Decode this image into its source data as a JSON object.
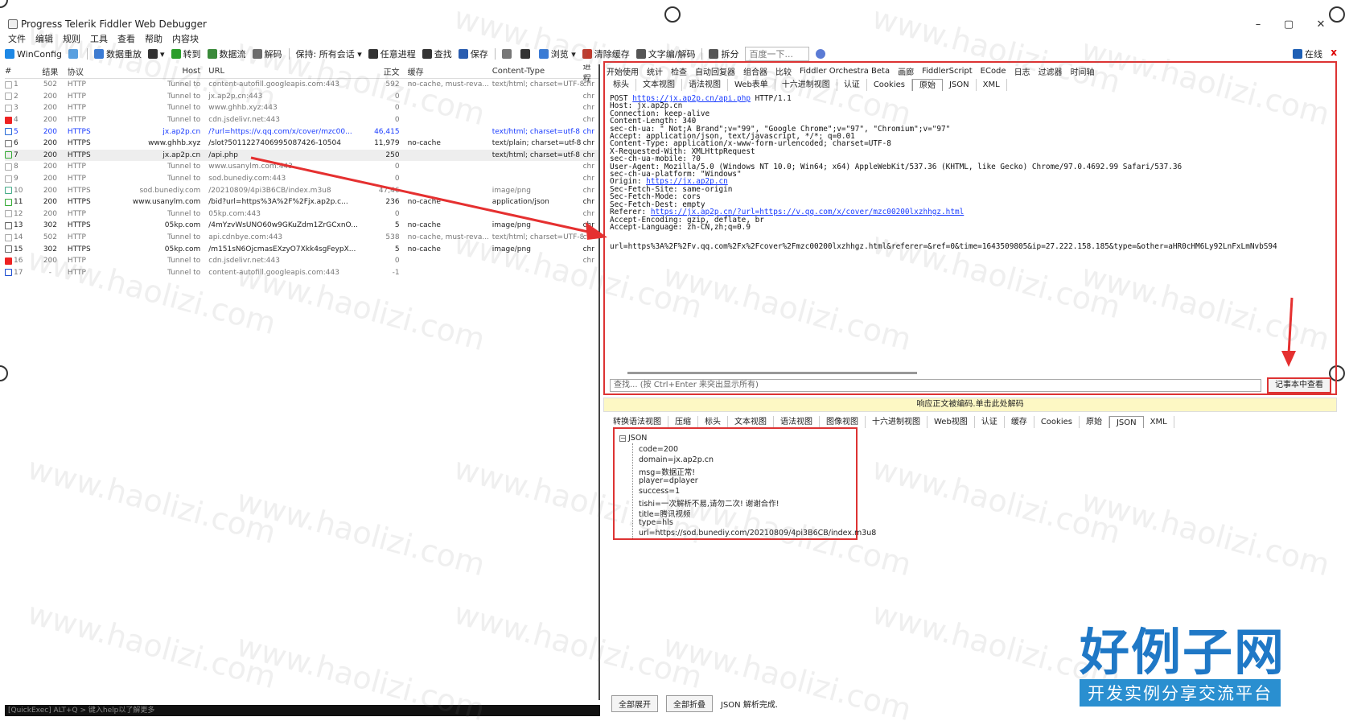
{
  "window": {
    "title": "Progress Telerik Fiddler Web Debugger",
    "minimize": "–",
    "maximize": "▢",
    "close": "✕"
  },
  "menu": [
    "文件",
    "编辑",
    "规则",
    "工具",
    "查看",
    "帮助",
    "内容块"
  ],
  "toolbar": {
    "items": [
      {
        "label": "WinConfig",
        "icon": "windows-icon",
        "color": "#1e88e5"
      },
      {
        "label": "",
        "icon": "comment-icon",
        "color": "#5aa0e0"
      },
      {
        "label": "数据重放",
        "icon": "replay-icon",
        "color": "#3a7bd5"
      },
      {
        "label": "▾",
        "icon": "remove-icon",
        "color": "#333333"
      },
      {
        "label": "转到",
        "icon": "go-icon",
        "color": "#2a9d2a"
      },
      {
        "label": "数据流",
        "icon": "stream-icon",
        "color": "#3a8a3a"
      },
      {
        "label": "解码",
        "icon": "decode-icon",
        "color": "#6a6a6a"
      },
      {
        "label": "保持: 所有会话 ▾",
        "icon": "",
        "color": ""
      },
      {
        "label": "任意进程",
        "icon": "target-icon",
        "color": "#333333"
      },
      {
        "label": "查找",
        "icon": "binoculars-icon",
        "color": "#333333"
      },
      {
        "label": "保存",
        "icon": "save-icon",
        "color": "#2a5db0"
      },
      {
        "label": "",
        "icon": "camera-icon",
        "color": "#777777"
      },
      {
        "label": "",
        "icon": "timer-icon",
        "color": "#333333"
      },
      {
        "label": "浏览 ▾",
        "icon": "browse-icon",
        "color": "#3a7bd5"
      },
      {
        "label": "清除缓存",
        "icon": "clear-cache-icon",
        "color": "#c0392b"
      },
      {
        "label": "文字编/解码",
        "icon": "text-encode-icon",
        "color": "#555555"
      },
      {
        "label": "拆分",
        "icon": "split-icon",
        "color": "#555555"
      }
    ],
    "search_placeholder": "百度一下...",
    "online": "在线",
    "close_x": "x"
  },
  "sessions": {
    "columns": [
      "#",
      "结果",
      "协议",
      "Host",
      "URL",
      "正文",
      "缓存",
      "Content-Type",
      "进程"
    ],
    "rows": [
      {
        "id": "1",
        "result": "502",
        "proto": "HTTP",
        "host": "Tunnel to",
        "url": "content-autofill.googleapis.com:443",
        "body": "592",
        "cache": "no-cache, must-reva...",
        "ct": "text/html; charset=UTF-8",
        "proc": "chr",
        "style": "gray",
        "icon": "lock-icon"
      },
      {
        "id": "2",
        "result": "200",
        "proto": "HTTP",
        "host": "Tunnel to",
        "url": "jx.ap2p.cn:443",
        "body": "0",
        "cache": "",
        "ct": "",
        "proc": "chr",
        "style": "gray",
        "icon": "lock-icon"
      },
      {
        "id": "3",
        "result": "200",
        "proto": "HTTP",
        "host": "Tunnel to",
        "url": "www.ghhb.xyz:443",
        "body": "0",
        "cache": "",
        "ct": "",
        "proc": "chr",
        "style": "gray",
        "icon": "lock-icon"
      },
      {
        "id": "4",
        "result": "200",
        "proto": "HTTP",
        "host": "Tunnel to",
        "url": "cdn.jsdelivr.net:443",
        "body": "0",
        "cache": "",
        "ct": "",
        "proc": "chr",
        "style": "gray",
        "icon": "warning-icon"
      },
      {
        "id": "5",
        "result": "200",
        "proto": "HTTPS",
        "host": "jx.ap2p.cn",
        "url": "/?url=https://v.qq.com/x/cover/mzc00...",
        "body": "46,415",
        "cache": "",
        "ct": "text/html; charset=utf-8",
        "proc": "chr",
        "style": "blue",
        "icon": "html-icon"
      },
      {
        "id": "6",
        "result": "200",
        "proto": "HTTPS",
        "host": "www.ghhb.xyz",
        "url": "/slot?5011227406995087426-10504",
        "body": "11,979",
        "cache": "no-cache",
        "ct": "text/plain; charset=utf-8",
        "proc": "chr",
        "style": "dark",
        "icon": "doc-icon"
      },
      {
        "id": "7",
        "result": "200",
        "proto": "HTTPS",
        "host": "jx.ap2p.cn",
        "url": "/api.php",
        "body": "250",
        "cache": "",
        "ct": "text/html; charset=utf-8",
        "proc": "chr",
        "style": "dark",
        "icon": "json-icon"
      },
      {
        "id": "8",
        "result": "200",
        "proto": "HTTP",
        "host": "Tunnel to",
        "url": "www.usanylm.com:443",
        "body": "0",
        "cache": "",
        "ct": "",
        "proc": "chr",
        "style": "gray",
        "icon": "lock-icon"
      },
      {
        "id": "9",
        "result": "200",
        "proto": "HTTP",
        "host": "Tunnel to",
        "url": "sod.bunediy.com:443",
        "body": "0",
        "cache": "",
        "ct": "",
        "proc": "chr",
        "style": "gray",
        "icon": "lock-icon"
      },
      {
        "id": "10",
        "result": "200",
        "proto": "HTTPS",
        "host": "sod.bunediy.com",
        "url": "/20210809/4pi3B6CB/index.m3u8",
        "body": "47,46",
        "cache": "",
        "ct": "image/png",
        "proc": "chr",
        "style": "gray",
        "icon": "image-icon"
      },
      {
        "id": "11",
        "result": "200",
        "proto": "HTTPS",
        "host": "www.usanylm.com",
        "url": "/bid?url=https%3A%2F%2Fjx.ap2p.c...",
        "body": "236",
        "cache": "no-cache",
        "ct": "application/json",
        "proc": "chr",
        "style": "dark",
        "icon": "json-icon"
      },
      {
        "id": "12",
        "result": "200",
        "proto": "HTTP",
        "host": "Tunnel to",
        "url": "05kp.com:443",
        "body": "0",
        "cache": "",
        "ct": "",
        "proc": "chr",
        "style": "gray",
        "icon": "lock-icon"
      },
      {
        "id": "13",
        "result": "302",
        "proto": "HTTPS",
        "host": "05kp.com",
        "url": "/4mYzvWsUNO60w9GKuZdm1ZrGCxnO...",
        "body": "5",
        "cache": "no-cache",
        "ct": "image/png",
        "proc": "chr",
        "style": "dark",
        "icon": "redirect-icon"
      },
      {
        "id": "14",
        "result": "502",
        "proto": "HTTP",
        "host": "Tunnel to",
        "url": "api.cdnbye.com:443",
        "body": "538",
        "cache": "no-cache, must-reva...",
        "ct": "text/html; charset=UTF-8",
        "proc": "chr",
        "style": "gray",
        "icon": "lock-icon"
      },
      {
        "id": "15",
        "result": "302",
        "proto": "HTTPS",
        "host": "05kp.com",
        "url": "/m151sN6OjcmasEXzyO7Xkk4sgFeypX...",
        "body": "5",
        "cache": "no-cache",
        "ct": "image/png",
        "proc": "chr",
        "style": "dark",
        "icon": "redirect-icon"
      },
      {
        "id": "16",
        "result": "200",
        "proto": "HTTP",
        "host": "Tunnel to",
        "url": "cdn.jsdelivr.net:443",
        "body": "0",
        "cache": "",
        "ct": "",
        "proc": "chr",
        "style": "gray",
        "icon": "warning-icon"
      },
      {
        "id": "17",
        "result": "-",
        "proto": "HTTP",
        "host": "Tunnel to",
        "url": "content-autofill.googleapis.com:443",
        "body": "-1",
        "cache": "",
        "ct": "",
        "proc": "",
        "style": "gray",
        "icon": "upload-icon"
      }
    ]
  },
  "quickexec": "[QuickExec] ALT+Q > 键入help以了解更多",
  "inspector": {
    "top_tabs": [
      "开始使用",
      "统计",
      "检查",
      "自动回复器",
      "组合器",
      "比较",
      "Fiddler Orchestra Beta",
      "画廊",
      "FiddlerScript",
      "ECode",
      "日志",
      "过滤器",
      "时间轴"
    ],
    "request_tabs": [
      "标头",
      "文本视图",
      "语法视图",
      "Web表单",
      "十六进制视图",
      "认证",
      "Cookies",
      "原始",
      "JSON",
      "XML"
    ],
    "request_active": "原始",
    "raw_lines": [
      "POST |https://jx.ap2p.cn/api.php| HTTP/1.1",
      "Host: jx.ap2p.cn",
      "Connection: keep-alive",
      "Content-Length: 340",
      "sec-ch-ua: \" Not;A Brand\";v=\"99\", \"Google Chrome\";v=\"97\", \"Chromium\";v=\"97\"",
      "Accept: application/json, text/javascript, */*; q=0.01",
      "Content-Type: application/x-www-form-urlencoded; charset=UTF-8",
      "X-Requested-With: XMLHttpRequest",
      "sec-ch-ua-mobile: ?0",
      "User-Agent: Mozilla/5.0 (Windows NT 10.0; Win64; x64) AppleWebKit/537.36 (KHTML, like Gecko) Chrome/97.0.4692.99 Safari/537.36",
      "sec-ch-ua-platform: \"Windows\"",
      "Origin: |https://jx.ap2p.cn|",
      "Sec-Fetch-Site: same-origin",
      "Sec-Fetch-Mode: cors",
      "Sec-Fetch-Dest: empty",
      "Referer: |https://jx.ap2p.cn/?url=https://v.qq.com/x/cover/mzc00200lxzhhgz.html|",
      "Accept-Encoding: gzip, deflate, br",
      "Accept-Language: zh-CN,zh;q=0.9"
    ],
    "raw_body": "url=https%3A%2F%2Fv.qq.com%2Fx%2Fcover%2Fmzc00200lxzhhgz.html&referer=&ref=0&time=1643509805&ip=27.222.158.185&type=&other=aHR0cHM6Ly92LnFxLmNvbS94",
    "find_placeholder": "查找... (按 Ctrl+Enter 来突出显示所有)",
    "find_button": "记事本中查看",
    "decode_notice": "响应正文被编码.单击此处解码",
    "response_tabs": [
      "转换语法视图",
      "压缩",
      "标头",
      "文本视图",
      "语法视图",
      "图像视图",
      "十六进制视图",
      "Web视图",
      "认证",
      "缓存",
      "Cookies",
      "原始",
      "JSON",
      "XML"
    ],
    "response_active": "JSON",
    "json_root": "JSON",
    "json_nodes": [
      "code=200",
      "domain=jx.ap2p.cn",
      "msg=数据正常!",
      "player=dplayer",
      "success=1",
      "tishi=一次解析不易,请勿二次! 谢谢合作!",
      "title=腾讯视频",
      "type=hls",
      "url=https://sod.bunediy.com/20210809/4pi3B6CB/index.m3u8"
    ],
    "expand_all": "全部展开",
    "collapse_all": "全部折叠",
    "json_status": "JSON 解析完成."
  },
  "watermark": "www.haolizi.com",
  "brand": {
    "main": "好例子网",
    "sub": "开发实例分享交流平台"
  },
  "colors": {
    "highlight": "#d33333",
    "link": "#1a3cff",
    "brand": "#1f78c6"
  }
}
